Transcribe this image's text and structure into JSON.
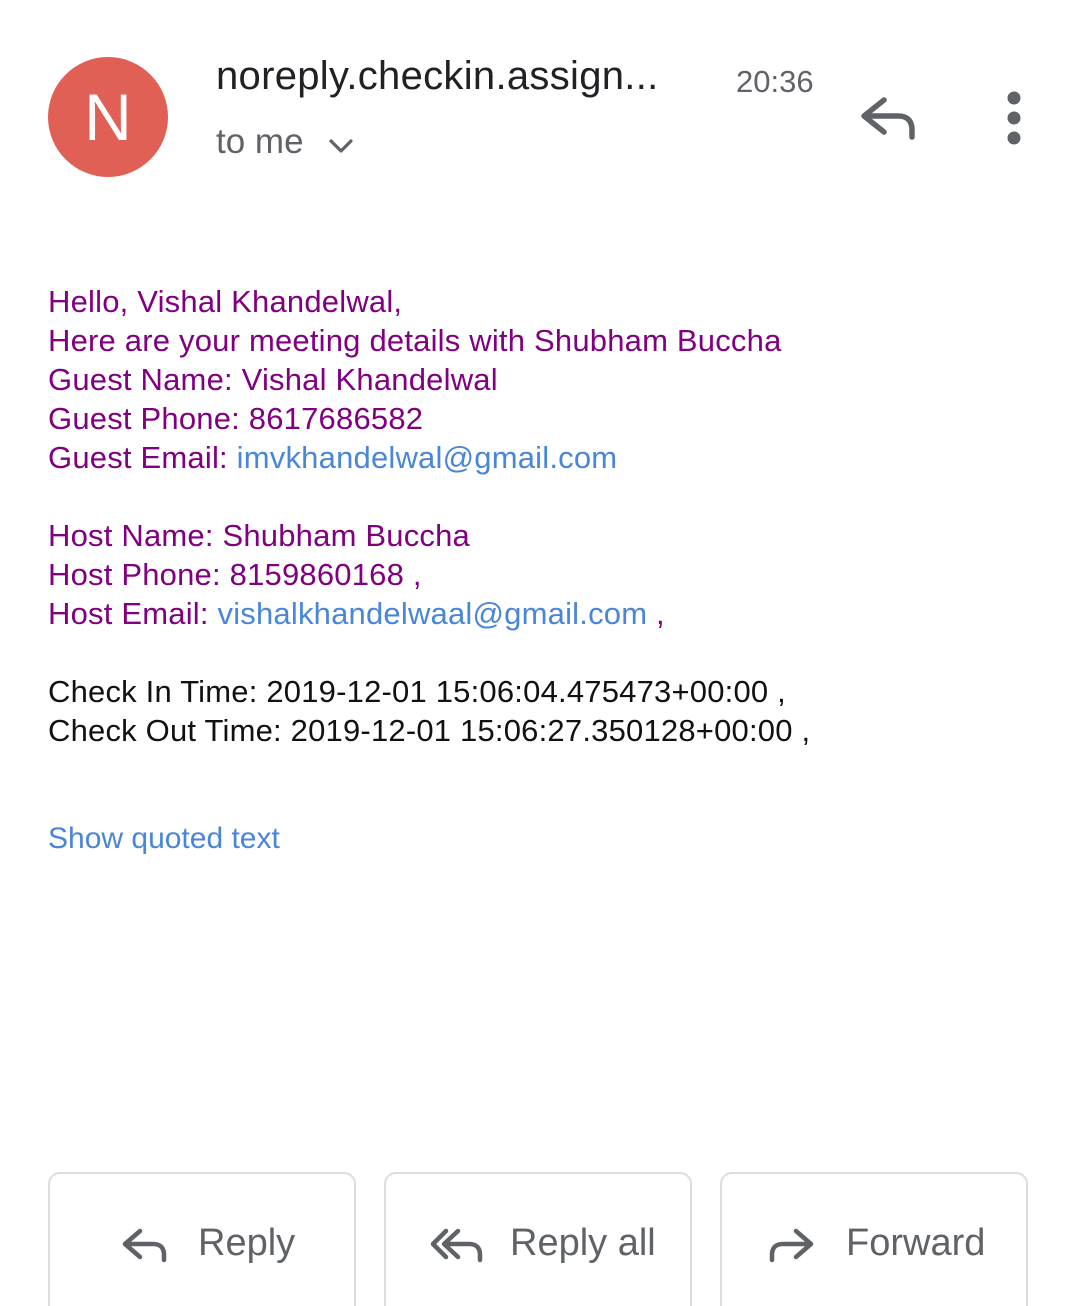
{
  "colors": {
    "avatar_bg": "#e06055",
    "body_text": "#800080",
    "link": "#4a86d8",
    "icon_gray": "#5f6368"
  },
  "header": {
    "avatar_letter": "N",
    "sender": "noreply.checkin.assign...",
    "time": "20:36",
    "recipient_label": "to me",
    "icons": [
      "reply-icon",
      "more-vert-icon",
      "chevron-down-icon"
    ]
  },
  "message": {
    "greeting": "Hello, Vishal Khandelwal,",
    "intro": "Here are your meeting details with Shubham Buccha",
    "guest_name_label": "Guest Name: ",
    "guest_name": "Vishal Khandelwal",
    "guest_phone_label": "Guest Phone: ",
    "guest_phone": "8617686582",
    "guest_email_label": "Guest Email: ",
    "guest_email": "imvkhandelwal@gmail.com",
    "host_name_label": "Host Name: ",
    "host_name": "Shubham Buccha",
    "host_phone_label": "Host Phone: ",
    "host_phone": "8159860168 ,",
    "host_email_label": "Host Email: ",
    "host_email": "vishalkhandelwaal@gmail.com",
    "host_email_suffix": " ,",
    "check_in": "Check In Time: 2019-12-01 15:06:04.475473+00:00 ,",
    "check_out": "Check Out Time: 2019-12-01 15:06:27.350128+00:00 ,"
  },
  "show_quoted": "Show quoted text",
  "actions": {
    "reply": "Reply",
    "reply_all": "Reply all",
    "forward": "Forward"
  }
}
